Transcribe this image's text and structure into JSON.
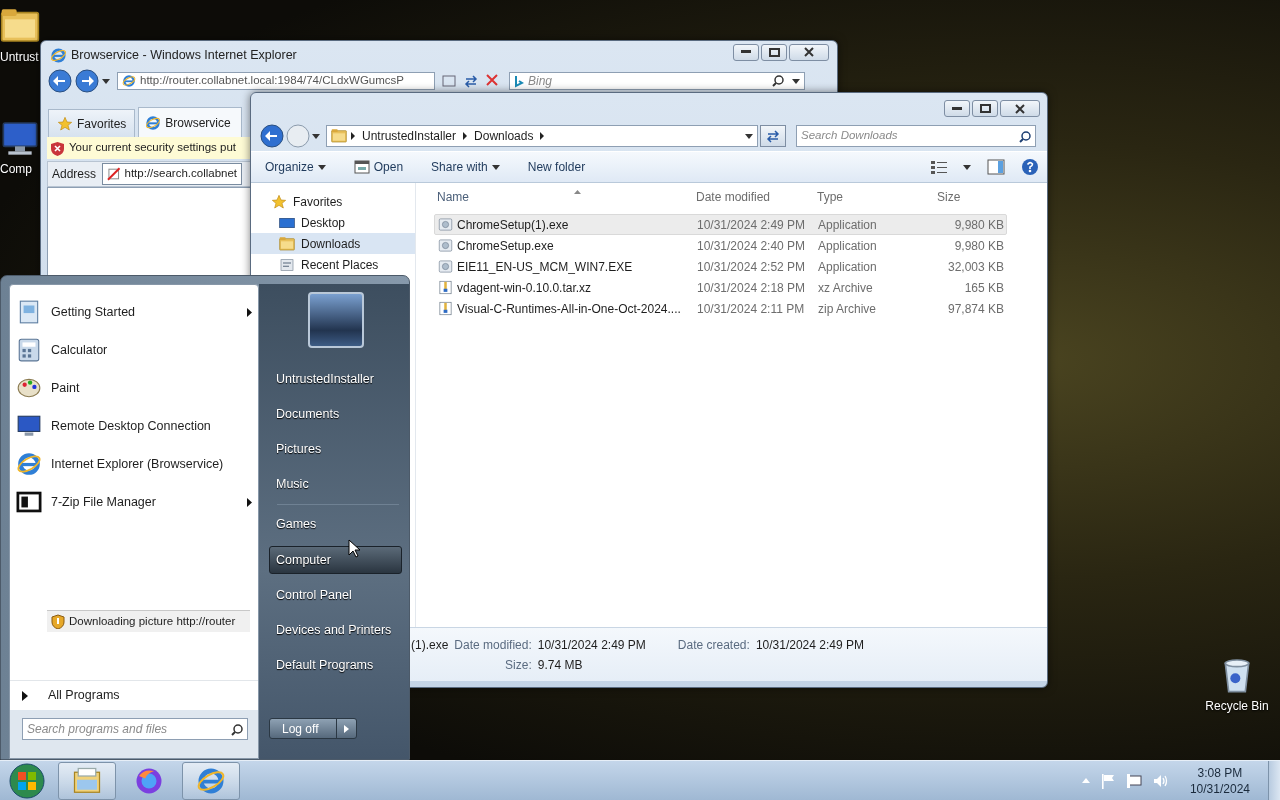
{
  "desktop": {
    "icons": [
      {
        "label": "Untrust",
        "kind": "folder"
      },
      {
        "label": "Comp",
        "kind": "computer"
      },
      {
        "label": "Recycle Bin",
        "kind": "recycle-bin"
      }
    ]
  },
  "ie_window": {
    "title": "Browservice - Windows Internet Explorer",
    "url": "http://router.collabnet.local:1984/74/CLdxWGumcsP",
    "search": {
      "placeholder": "Bing"
    },
    "favorites_button": "Favorites",
    "tab": "Browservice",
    "security_bar": "Your current security settings put",
    "address_label": "Address",
    "address_value": "http://search.collabnet",
    "status": "Downloading picture http://router"
  },
  "explorer": {
    "breadcrumb": [
      "UntrustedInstaller",
      "Downloads"
    ],
    "search": {
      "placeholder": "Search Downloads"
    },
    "toolbar": [
      {
        "label": "Organize",
        "kind": "menu"
      },
      {
        "label": "Open",
        "kind": "icon"
      },
      {
        "label": "Share with",
        "kind": "menu"
      },
      {
        "label": "New folder",
        "kind": "plain"
      }
    ],
    "nav": [
      {
        "label": "Favorites",
        "kind": "star",
        "selected": false
      },
      {
        "label": "Desktop",
        "kind": "desktop",
        "selected": false
      },
      {
        "label": "Downloads",
        "kind": "folder",
        "selected": true
      },
      {
        "label": "Recent Places",
        "kind": "recent",
        "selected": false
      }
    ],
    "columns": [
      "Name",
      "Date modified",
      "Type",
      "Size"
    ],
    "files": [
      {
        "name": "ChromeSetup(1).exe",
        "date": "10/31/2024 2:49 PM",
        "type": "Application",
        "size": "9,980 KB",
        "kind": "application",
        "selected": true
      },
      {
        "name": "ChromeSetup.exe",
        "date": "10/31/2024 2:40 PM",
        "type": "Application",
        "size": "9,980 KB",
        "kind": "application",
        "selected": false
      },
      {
        "name": "EIE11_EN-US_MCM_WIN7.EXE",
        "date": "10/31/2024 2:52 PM",
        "type": "Application",
        "size": "32,003 KB",
        "kind": "application",
        "selected": false
      },
      {
        "name": "vdagent-win-0.10.0.tar.xz",
        "date": "10/31/2024 2:18 PM",
        "type": "xz Archive",
        "size": "165 KB",
        "kind": "archive",
        "selected": false
      },
      {
        "name": "Visual-C-Runtimes-All-in-One-Oct-2024....",
        "date": "10/31/2024 2:11 PM",
        "type": "zip Archive",
        "size": "97,874 KB",
        "kind": "archive",
        "selected": false
      }
    ],
    "details": {
      "name": "(1).exe",
      "fields": [
        {
          "label": "Date modified:",
          "value": "10/31/2024 2:49 PM"
        },
        {
          "label": "Date created:",
          "value": "10/31/2024 2:49 PM"
        },
        {
          "label": "Size:",
          "value": "9.74 MB"
        }
      ]
    }
  },
  "start_menu": {
    "programs": [
      {
        "label": "Getting Started",
        "kind": "getting-started",
        "submenu": true
      },
      {
        "label": "Calculator",
        "kind": "calculator",
        "submenu": false
      },
      {
        "label": "Paint",
        "kind": "paint",
        "submenu": false
      },
      {
        "label": "Remote Desktop Connection",
        "kind": "remote-desktop",
        "submenu": false
      },
      {
        "label": "Internet Explorer (Browservice)",
        "kind": "ie",
        "submenu": false
      },
      {
        "label": "7-Zip File Manager",
        "kind": "archiver",
        "submenu": true
      }
    ],
    "all_programs": "All Programs",
    "search": {
      "placeholder": "Search programs and files"
    },
    "place_groups": [
      [
        {
          "label": "UntrustedInstaller",
          "selected": false
        },
        {
          "label": "Documents",
          "selected": false
        },
        {
          "label": "Pictures",
          "selected": false
        },
        {
          "label": "Music",
          "selected": false
        }
      ],
      [
        {
          "label": "Games",
          "selected": false
        },
        {
          "label": "Computer",
          "selected": true
        },
        {
          "label": "Control Panel",
          "selected": false
        },
        {
          "label": "Devices and Printers",
          "selected": false
        },
        {
          "label": "Default Programs",
          "selected": false
        }
      ]
    ],
    "log_off": "Log off"
  },
  "taskbar": {
    "buttons": [
      {
        "kind": "explorer",
        "open": true
      },
      {
        "kind": "firefox",
        "open": false
      },
      {
        "kind": "ie",
        "open": true
      }
    ],
    "time": "3:08 PM",
    "date": "10/31/2024"
  }
}
